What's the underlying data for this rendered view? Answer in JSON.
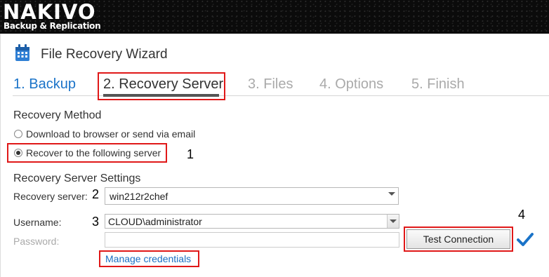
{
  "header": {
    "logo": "NAKIVO",
    "tagline": "Backup & Replication"
  },
  "wizard": {
    "title": "File Recovery Wizard"
  },
  "steps": [
    {
      "label": "1. Backup"
    },
    {
      "label": "2. Recovery Server"
    },
    {
      "label": "3. Files"
    },
    {
      "label": "4. Options"
    },
    {
      "label": "5. Finish"
    }
  ],
  "recovery_method": {
    "heading": "Recovery Method",
    "option_download": "Download to browser or send via email",
    "option_server": "Recover to the following server",
    "selected": "Recover to the following server"
  },
  "server_settings": {
    "heading": "Recovery Server Settings",
    "server_label": "Recovery server:",
    "server_value": "win212r2chef",
    "username_label": "Username:",
    "username_value": "CLOUD\\administrator",
    "password_label": "Password:",
    "password_value": "",
    "manage_link": "Manage credentials",
    "test_button": "Test Connection"
  },
  "annotations": {
    "n1": "1",
    "n2": "2",
    "n3": "3",
    "n4": "4"
  },
  "colors": {
    "accent": "#1a73c8",
    "highlight": "#e01818",
    "check": "#1a73c8"
  }
}
